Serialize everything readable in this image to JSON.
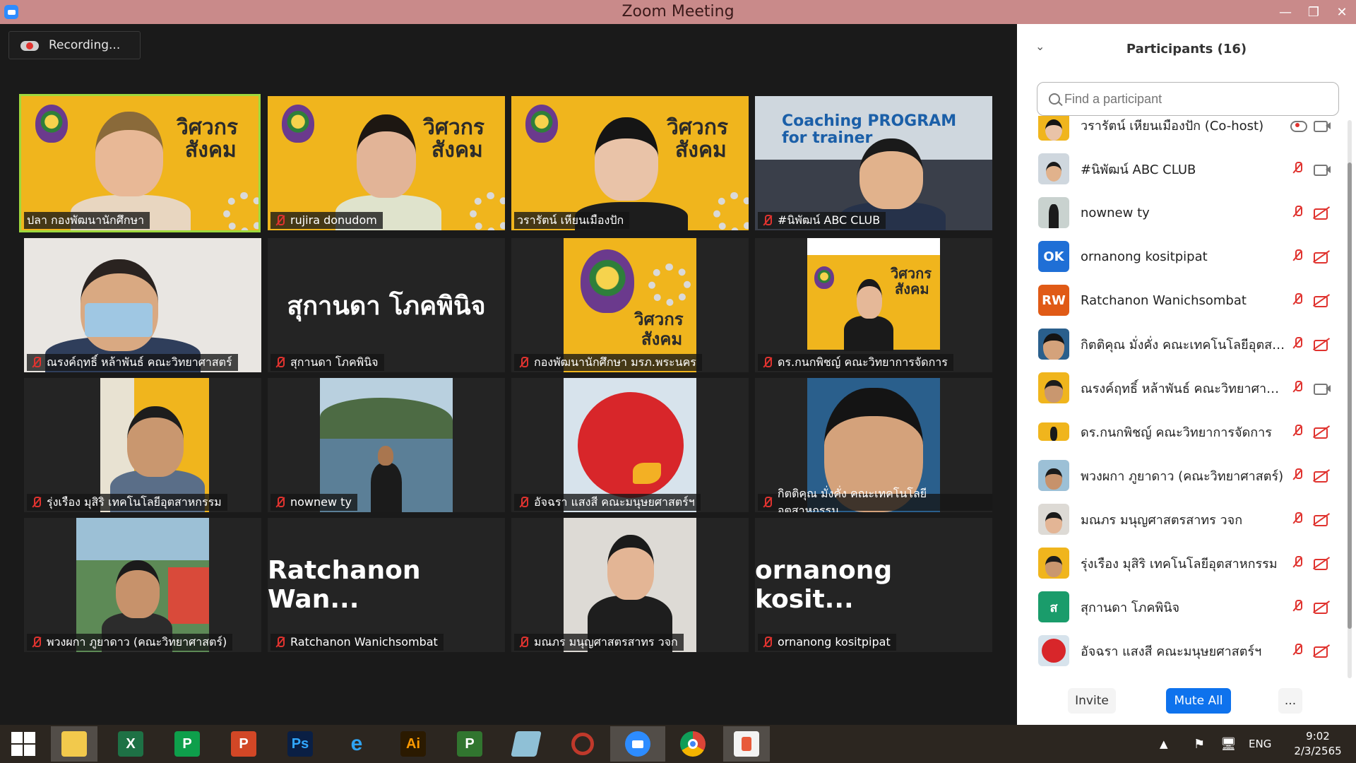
{
  "window": {
    "title": "Zoom Meeting",
    "minimize": "—",
    "restore": "❐",
    "close": "✕"
  },
  "recording": {
    "label": "Recording..."
  },
  "tiles": [
    {
      "name": "ปลา กองพัฒนานักศึกษา",
      "active": true,
      "muted": false
    },
    {
      "name": "rujira donudom",
      "muted": true
    },
    {
      "name": "วรารัตน์ เหียนเมืองปัก",
      "muted": false
    },
    {
      "name": "#นิพัฒน์ ABC CLUB",
      "muted": true,
      "poster_text": "Coaching PROGRAM for trainer"
    },
    {
      "name": "ณรงค์ฤทธิ์ หล้าพันธ์ คณะวิทยาศาสตร์",
      "muted": true
    },
    {
      "name": "สุกานดา โภคพินิจ",
      "muted": true,
      "big_name": "สุกานดา โภคพินิจ"
    },
    {
      "name": "กองพัฒนานักศึกษา มรภ.พระนคร",
      "muted": true
    },
    {
      "name": "ดร.กนกพิชญ์ คณะวิทยาการจัดการ",
      "muted": true
    },
    {
      "name": "รุ่งเรือง มุสิริ เทคโนโลยีอุตสาหกรรม",
      "muted": true
    },
    {
      "name": "nownew ty",
      "muted": true
    },
    {
      "name": "อัจฉรา แสงสี คณะมนุษยศาสตร์ฯ",
      "muted": true
    },
    {
      "name": "กิตติคุณ มั่งคั่ง คณะเทคโนโลยีอุตสาหกรรม",
      "muted": true
    },
    {
      "name": "พวงผกา ภูยาดาว (คณะวิทยาศาสตร์)",
      "muted": true
    },
    {
      "name": "Ratchanon Wanichsombat",
      "muted": true,
      "big_name": "Ratchanon Wan..."
    },
    {
      "name": "มณภร มนุญศาสตรสาทร วจก",
      "muted": true
    },
    {
      "name": "ornanong kositpipat",
      "muted": true,
      "big_name": "ornanong kosit..."
    }
  ],
  "poster": {
    "line1": "วิศวกร",
    "line2": "สังคม"
  },
  "panel": {
    "title": "Participants (16)",
    "search_placeholder": "Find a participant",
    "participants": [
      {
        "name": "วรารัตน์ เหียนเมืองปัก (Co-host)",
        "avatar": "photo",
        "mic": "cloud",
        "cam": "on"
      },
      {
        "name": "#นิพัฒน์ ABC CLUB",
        "avatar": "photo",
        "mic": "muted",
        "cam": "on"
      },
      {
        "name": "nownew ty",
        "avatar": "photo",
        "mic": "muted",
        "cam": "off"
      },
      {
        "name": "ornanong kositpipat",
        "avatar": "OK",
        "avatar_color": "#1f6fd6",
        "mic": "muted",
        "cam": "off"
      },
      {
        "name": "Ratchanon Wanichsombat",
        "avatar": "RW",
        "avatar_color": "#e05a16",
        "mic": "muted",
        "cam": "off"
      },
      {
        "name": "กิตติคุณ มั่งคั่ง คณะเทคโนโลยีอุตสาห...",
        "avatar": "photo",
        "mic": "muted",
        "cam": "off"
      },
      {
        "name": "ณรงค์ฤทธิ์ หล้าพันธ์ คณะวิทยาศาสตร์",
        "avatar": "photo",
        "mic": "muted",
        "cam": "on"
      },
      {
        "name": "ดร.กนกพิชญ์ คณะวิทยาการจัดการ",
        "avatar": "photo",
        "mic": "muted",
        "cam": "off"
      },
      {
        "name": "พวงผกา ภูยาดาว (คณะวิทยาศาสตร์)",
        "avatar": "photo",
        "mic": "muted",
        "cam": "off"
      },
      {
        "name": "มณภร มนุญศาสตรสาทร วจก",
        "avatar": "photo",
        "mic": "muted",
        "cam": "off"
      },
      {
        "name": "รุ่งเรือง มุสิริ เทคโนโลยีอุตสาหกรรม",
        "avatar": "photo",
        "mic": "muted",
        "cam": "off"
      },
      {
        "name": "สุกานดา โภคพินิจ",
        "avatar": "ส",
        "avatar_color": "#1a9c6b",
        "mic": "muted",
        "cam": "off"
      },
      {
        "name": "อัจฉรา แสงสี คณะมนุษยศาสตร์ฯ",
        "avatar": "photo",
        "mic": "muted",
        "cam": "off"
      }
    ],
    "invite": "Invite",
    "mute_all": "Mute All",
    "more": "..."
  },
  "taskbar": {
    "apps": [
      "windows-start",
      "file-explorer",
      "excel",
      "publisher",
      "powerpoint",
      "photoshop",
      "internet-explorer",
      "illustrator",
      "project",
      "notepad",
      "photoscape",
      "zoom",
      "chrome",
      "paint"
    ],
    "excel_label": "X",
    "publisher_label": "P",
    "powerpoint_label": "P",
    "photoshop_label": "Ps",
    "illustrator_label": "Ai",
    "project_label": "P",
    "language": "ENG",
    "time": "9:02",
    "date": "2/3/2565"
  },
  "colors": {
    "accent": "#0e72ed",
    "muted_red": "#e0332f",
    "active_speaker": "#9ed93d",
    "poster_yellow": "#f0b51d"
  }
}
